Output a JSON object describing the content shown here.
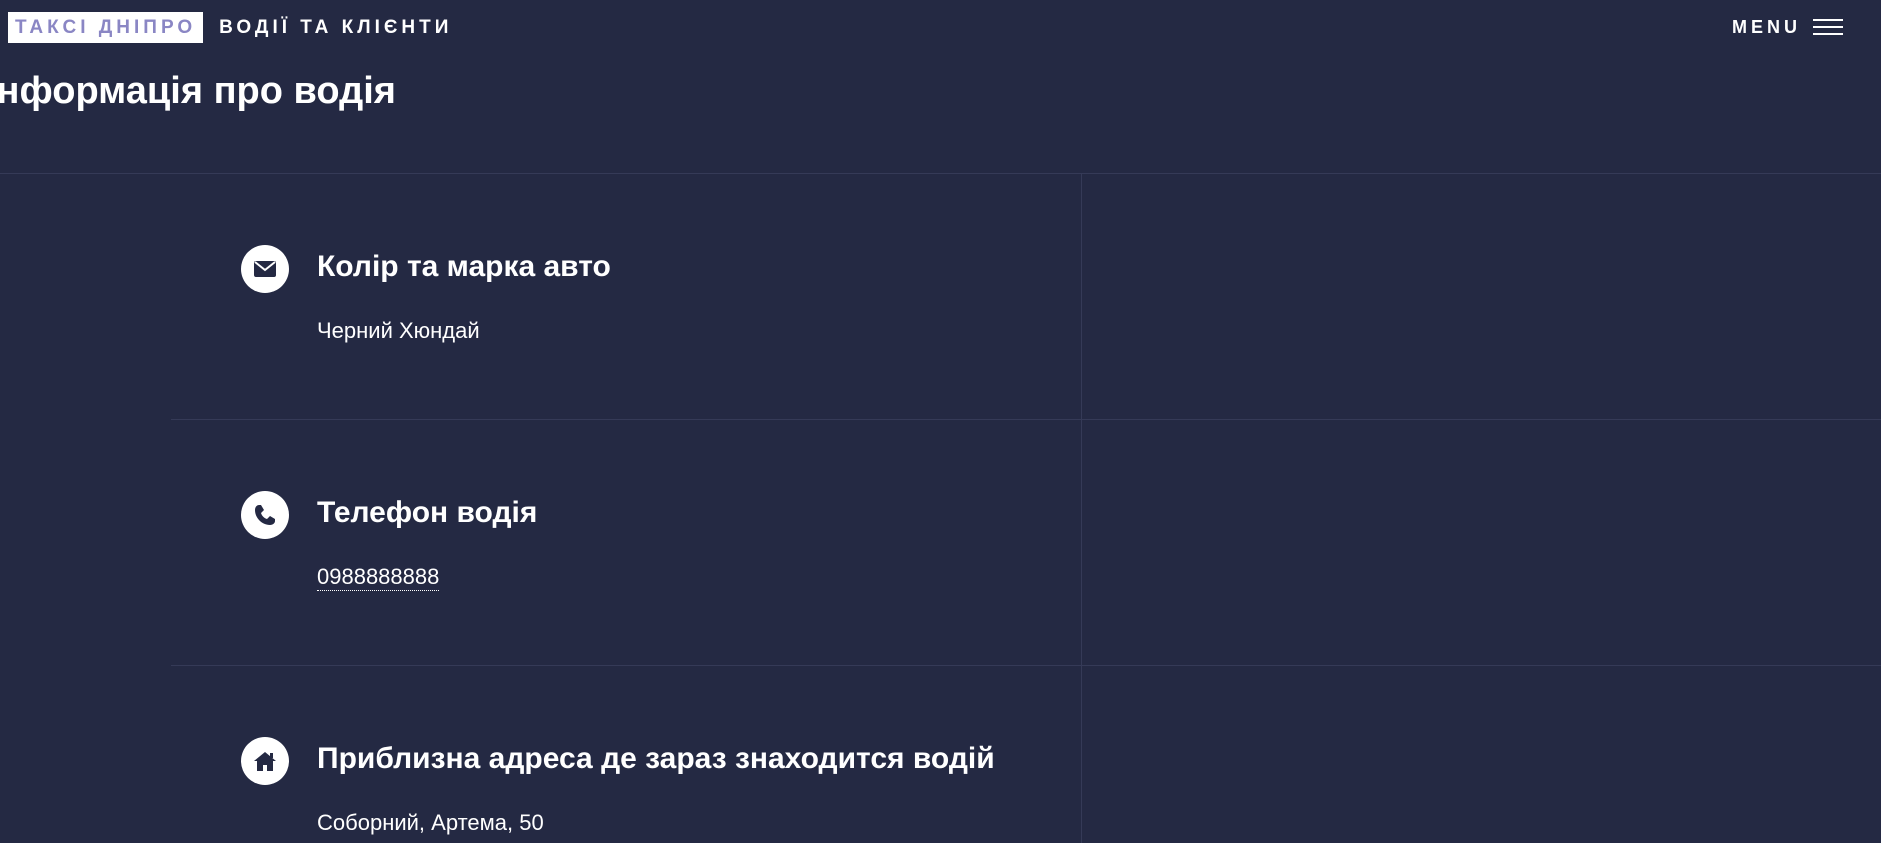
{
  "header": {
    "logo_primary": "ТАКСІ ДНІПРО",
    "logo_secondary": "ВОДІЇ ТА КЛІЄНТИ",
    "menu_label": "MENU",
    "menu_icon": "hamburger-menu-icon"
  },
  "banner": {
    "title": "Інформація про водія"
  },
  "contact": {
    "items": [
      {
        "icon": "envelope-icon",
        "title": "Колір та марка авто",
        "value": "Черний Хюндай"
      },
      {
        "icon": "phone-icon",
        "title": "Телефон водія",
        "value": "0988888888"
      },
      {
        "icon": "home-icon",
        "title": "Приблизна адреса де зараз знаходится водій",
        "value": "Соборний, Артема, 50"
      }
    ]
  },
  "colors": {
    "background": "#242943",
    "text": "#ffffff",
    "logo_accent": "#8a86c4",
    "divider": "#353a57"
  }
}
